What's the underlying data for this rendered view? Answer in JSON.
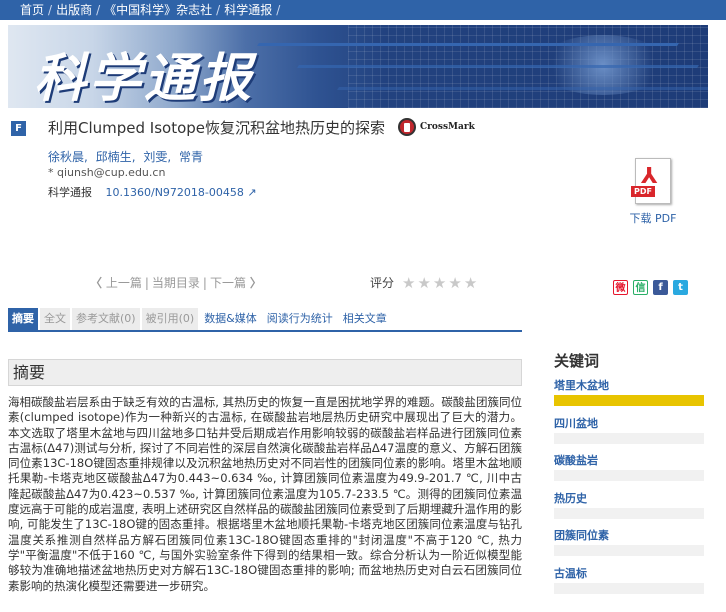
{
  "nav": {
    "items": [
      "首页",
      "出版商",
      "《中国科学》杂志社",
      "科学通报"
    ],
    "separator": "/"
  },
  "banner": {
    "title": "科学通报"
  },
  "article": {
    "badge": "F",
    "title": "利用Clumped Isotope恢复沉积盆地热历史的探索",
    "crossmark": "CrossMark",
    "authors": [
      "徐秋晨",
      "邱楠生",
      "刘雯",
      "常青"
    ],
    "email": "* qiunsh@cup.edu.cn",
    "journal": "科学通报",
    "doi": "10.1360/N972018-00458"
  },
  "pdf": {
    "tag": "PDF",
    "label": "下载 PDF"
  },
  "pager": {
    "prev": "上一篇",
    "current": "当期目录",
    "next": "下一篇"
  },
  "rating": {
    "label": "评分",
    "stars": 5,
    "filled": 0
  },
  "share": {
    "weibo": "微",
    "wechat": "信",
    "facebook": "f",
    "twitter": "t"
  },
  "tabs": [
    {
      "label": "摘要",
      "state": "active"
    },
    {
      "label": "全文",
      "state": "disabled"
    },
    {
      "label": "参考文献(0)",
      "state": "disabled"
    },
    {
      "label": "被引用(0)",
      "state": "disabled"
    },
    {
      "label": "数据&媒体",
      "state": "link"
    },
    {
      "label": "阅读行为统计",
      "state": "link"
    },
    {
      "label": "相关文章",
      "state": "link"
    }
  ],
  "abstract": {
    "heading": "摘要",
    "text": "海相碳酸盐岩层系由于缺乏有效的古温标, 其热历史的恢复一直是困扰地学界的难题。碳酸盐团簇同位素(clumped isotope)作为一种新兴的古温标, 在碳酸盐岩地层热历史研究中展现出了巨大的潜力。本文选取了塔里木盆地与四川盆地多口钻井受后期成岩作用影响较弱的碳酸盐岩样品进行团簇同位素古温标(Δ47)测试与分析, 探讨了不同岩性的深层自然演化碳酸盐岩样品Δ47温度的意义、方解石团簇同位素13C-18O键固态重排规律以及沉积盆地热历史对不同岩性的团簇同位素的影响。塔里木盆地顺托果勒-卡塔克地区碳酸盐Δ47为0.443~0.634 ‰, 计算团簇同位素温度为49.9-201.7 ℃, 川中古隆起碳酸盐Δ47为0.423~0.537 ‰, 计算团簇同位素温度为105.7-233.5 ℃。测得的团簇同位素温度远高于可能的成岩温度, 表明上述研究区自然样品的碳酸盐团簇同位素受到了后期埋藏升温作用的影响, 可能发生了13C-18O键的固态重排。根据塔里木盆地顺托果勒-卡塔克地区团簇同位素温度与钻孔温度关系推测自然样品方解石团簇同位素13C-18O键固态重排的\"封闭温度\"不高于120 ℃, 热力学\"平衡温度\"不低于160 ℃, 与国外实验室条件下得到的结果相一致。综合分析认为一阶近似模型能够较为准确地描述盆地热历史对方解石13C-18O键固态重排的影响; 而盆地热历史对白云石团簇同位素影响的热演化模型还需要进一步研究。"
  },
  "keywords": {
    "heading": "关键词",
    "items": [
      {
        "label": "塔里木盆地",
        "weight": 1.0
      },
      {
        "label": "四川盆地",
        "weight": 0.0
      },
      {
        "label": "碳酸盐岩",
        "weight": 0.0
      },
      {
        "label": "热历史",
        "weight": 0.0
      },
      {
        "label": "团簇同位素",
        "weight": 0.0
      },
      {
        "label": "古温标",
        "weight": 0.0
      }
    ]
  },
  "colors": {
    "brand": "#2f63a8",
    "keyword_bar": "#e8c400",
    "crossmark": "#c0272d",
    "pdf": "#d9262b"
  }
}
